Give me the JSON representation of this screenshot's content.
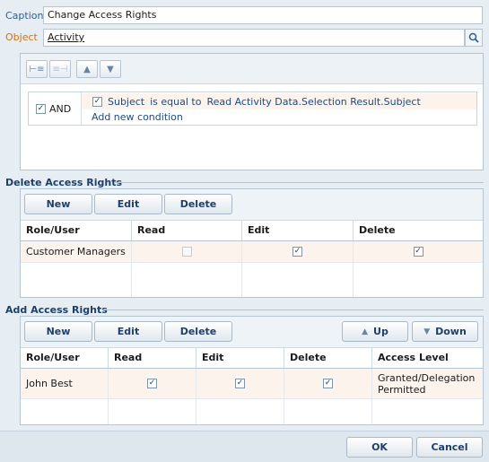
{
  "form": {
    "caption_label": "Caption",
    "caption_value": "Change Access Rights",
    "object_label": "Object",
    "object_value": "Activity"
  },
  "filter": {
    "group_operator": "AND",
    "condition": {
      "column": "Subject",
      "operator": "is equal to",
      "value": "Read Activity Data.Selection Result.Subject"
    },
    "add_condition_label": "Add new condition"
  },
  "delete_rights": {
    "title": "Delete Access Rights",
    "buttons": {
      "new": "New",
      "edit": "Edit",
      "delete": "Delete"
    },
    "columns": [
      "Role/User",
      "Read",
      "Edit",
      "Delete"
    ],
    "rows": [
      {
        "role": "Customer Managers",
        "read": false,
        "edit": true,
        "delete": true
      }
    ]
  },
  "add_rights": {
    "title": "Add Access Rights",
    "buttons": {
      "new": "New",
      "edit": "Edit",
      "delete": "Delete",
      "up": "Up",
      "down": "Down"
    },
    "columns": [
      "Role/User",
      "Read",
      "Edit",
      "Delete",
      "Access Level"
    ],
    "rows": [
      {
        "role": "John Best",
        "read": true,
        "edit": true,
        "delete": true,
        "access_level_line1": "Granted/Delegation",
        "access_level_line2": "Permitted"
      }
    ]
  },
  "footer": {
    "ok": "OK",
    "cancel": "Cancel"
  }
}
